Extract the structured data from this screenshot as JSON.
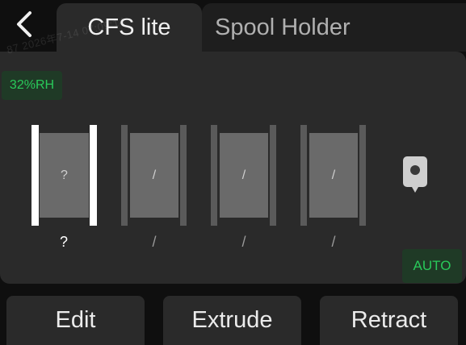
{
  "header": {
    "watermark_text": "87 2026年7-14 07:09:14",
    "tabs": [
      {
        "label": "CFS lite",
        "active": true
      },
      {
        "label": "Spool Holder",
        "active": false
      }
    ]
  },
  "status": {
    "humidity": "32%RH",
    "mode": "AUTO"
  },
  "slots": [
    {
      "inner": "?",
      "label": "?",
      "selected": true
    },
    {
      "inner": "/",
      "label": "/",
      "selected": false
    },
    {
      "inner": "/",
      "label": "/",
      "selected": false
    },
    {
      "inner": "/",
      "label": "/",
      "selected": false
    }
  ],
  "actions": {
    "edit": "Edit",
    "extrude": "Extrude",
    "retract": "Retract"
  },
  "colors": {
    "accent_green": "#29c95a",
    "panel": "#2a2a2a",
    "background": "#0f0f0f"
  },
  "icons": [
    "back-arrow-icon",
    "nozzle-icon"
  ]
}
